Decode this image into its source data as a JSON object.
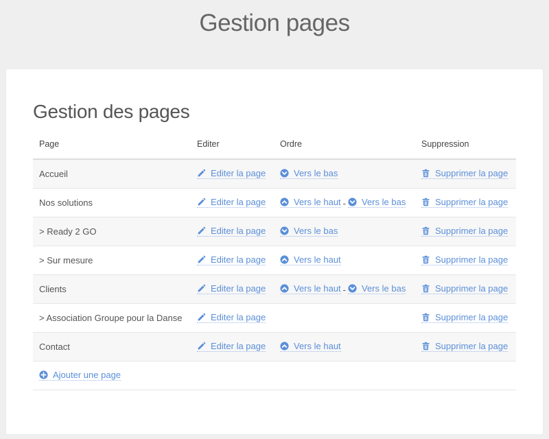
{
  "header": {
    "title": "Gestion pages"
  },
  "card": {
    "title": "Gestion des pages"
  },
  "table": {
    "columns": [
      "Page",
      "Editer",
      "Ordre",
      "Suppression"
    ],
    "edit_label": "Editer la page",
    "delete_label": "Supprimer la page",
    "up_label": "Vers le haut",
    "down_label": "Vers le bas",
    "separator": "-",
    "rows": [
      {
        "name": "Accueil",
        "up": false,
        "down": true
      },
      {
        "name": "Nos solutions",
        "up": true,
        "down": true
      },
      {
        "name": "> Ready 2 GO",
        "up": false,
        "down": true
      },
      {
        "name": "> Sur mesure",
        "up": true,
        "down": false
      },
      {
        "name": "Clients",
        "up": true,
        "down": true
      },
      {
        "name": "> Association Groupe pour la Danse",
        "up": false,
        "down": false
      },
      {
        "name": "Contact",
        "up": true,
        "down": false
      }
    ],
    "add_label": "Ajouter une page"
  },
  "colors": {
    "link": "#5b8fd8",
    "stripe": "#f7f7f7",
    "background": "#efefef"
  },
  "icons": {
    "edit": "pencil-icon",
    "up": "circle-chevron-up-icon",
    "down": "circle-chevron-down-icon",
    "delete": "trash-icon",
    "add": "plus-circle-icon"
  }
}
